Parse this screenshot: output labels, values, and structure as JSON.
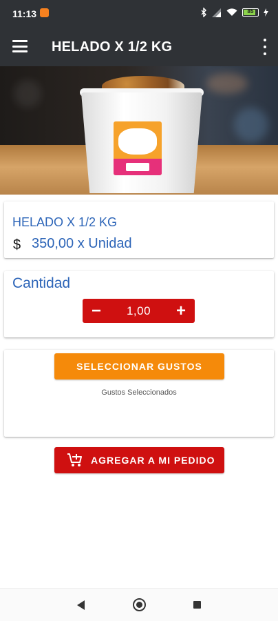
{
  "status_bar": {
    "time": "11:13",
    "battery_level": "85",
    "icons": [
      "notification-icon",
      "bluetooth-icon",
      "signal-icon",
      "wifi-icon",
      "battery-icon",
      "charging-icon"
    ]
  },
  "app_bar": {
    "title": "HELADO X 1/2 KG",
    "left_icon": "menu-icon",
    "right_icon": "more-vert-icon"
  },
  "product": {
    "name": "HELADO X 1/2 KG",
    "currency_symbol": "$",
    "price_text": "350,00 x Unidad"
  },
  "quantity": {
    "label": "Cantidad",
    "value": "1,00",
    "minus_label": "−",
    "plus_label": "+"
  },
  "flavors": {
    "button_label": "SELECCIONAR GUSTOS",
    "selected_label": "Gustos Seleccionados"
  },
  "order": {
    "button_label": "AGREGAR A MI PEDIDO",
    "icon": "add-cart-icon"
  },
  "colors": {
    "app_bar": "#2f3236",
    "accent_blue": "#2d65b8",
    "action_red": "#cf1010",
    "action_orange": "#f58a0a"
  }
}
